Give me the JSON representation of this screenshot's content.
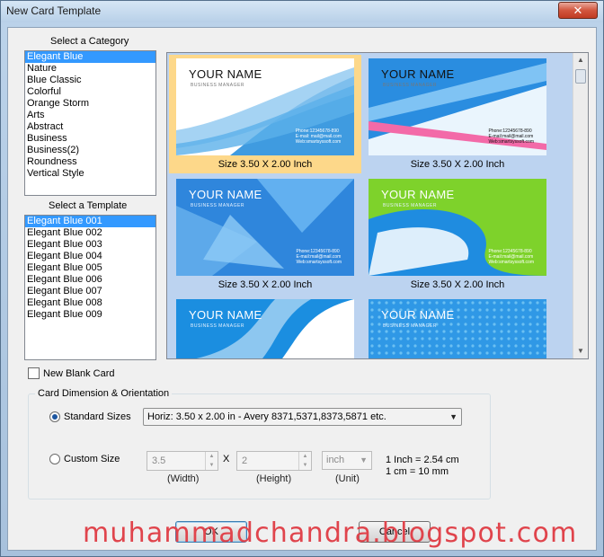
{
  "window": {
    "title": "New Card Template",
    "close_glyph": "✕"
  },
  "category": {
    "label": "Select a Category",
    "items": [
      "Elegant Blue",
      "Nature",
      "Blue Classic",
      "Colorful",
      "Orange Storm",
      "Arts",
      "Abstract",
      "Business",
      "Business(2)",
      "Roundness",
      "Vertical Style"
    ],
    "selected": 0
  },
  "template": {
    "label": "Select a Template",
    "items": [
      "Elegant Blue 001",
      "Elegant Blue 002",
      "Elegant Blue 003",
      "Elegant Blue 004",
      "Elegant Blue 005",
      "Elegant Blue 006",
      "Elegant Blue 007",
      "Elegant Blue 008",
      "Elegant Blue 009"
    ],
    "selected": 0
  },
  "gallery": {
    "selected": 0,
    "cards": [
      {
        "name": "YOUR NAME",
        "role": "BUSINESS MANAGER",
        "phone": "Phone:12345678-890",
        "email": "E-mail: mail@mail.com",
        "web": "Web:smartsyssoft.com",
        "size": "Size 3.50 X 2.00 Inch",
        "style": "wave"
      },
      {
        "name": "YOUR NAME",
        "role": "BUSINESS MANAGER",
        "phone": "Phone:12345678-890",
        "email": "E-mail:mail@mail.com",
        "web": "Web:smartsyssoft.com",
        "size": "Size 3.50 X 2.00 Inch",
        "style": "diagonal"
      },
      {
        "name": "YOUR NAME",
        "role": "BUSINESS MANAGER",
        "phone": "Phone:12345678-890",
        "email": "E-mail:mail@mail.com",
        "web": "Web:smartsyssoft.com",
        "size": "Size 3.50 X 2.00 Inch",
        "style": "shards"
      },
      {
        "name": "YOUR NAME",
        "role": "BUSINESS MANAGER",
        "phone": "Phone:12345678-890",
        "email": "E-mail:mail@mail.com",
        "web": "Web:smartsyssoft.com",
        "size": "Size 3.50 X 2.00 Inch",
        "style": "curl"
      },
      {
        "name": "YOUR NAME",
        "role": "BUSINESS MANAGER",
        "style": "swirl"
      },
      {
        "name": "YOUR NAME",
        "role": "BUSINESS MANAGER",
        "style": "dots"
      }
    ]
  },
  "new_blank_card": {
    "label": "New Blank Card",
    "checked": false
  },
  "dimension": {
    "group_label": "Card Dimension & Orientation",
    "standard_label": "Standard Sizes",
    "standard_value": "Horiz: 3.50 x 2.00 in - Avery 8371,5371,8373,5871 etc.",
    "custom_label": "Custom Size",
    "width_value": "3.5",
    "height_value": "2",
    "times": "X",
    "unit_value": "inch",
    "width_caption": "(Width)",
    "height_caption": "(Height)",
    "unit_caption": "(Unit)",
    "conversion_1": "1 Inch = 2.54 cm",
    "conversion_2": "1 cm = 10 mm",
    "selected": "standard"
  },
  "buttons": {
    "ok": "OK",
    "cancel": "Cancel"
  },
  "watermark": "muhammadchandra.blogspot.com",
  "colors": {
    "selection": "#3399ff",
    "tile_highlight": "#fdd88a",
    "watermark": "#e0444c"
  }
}
